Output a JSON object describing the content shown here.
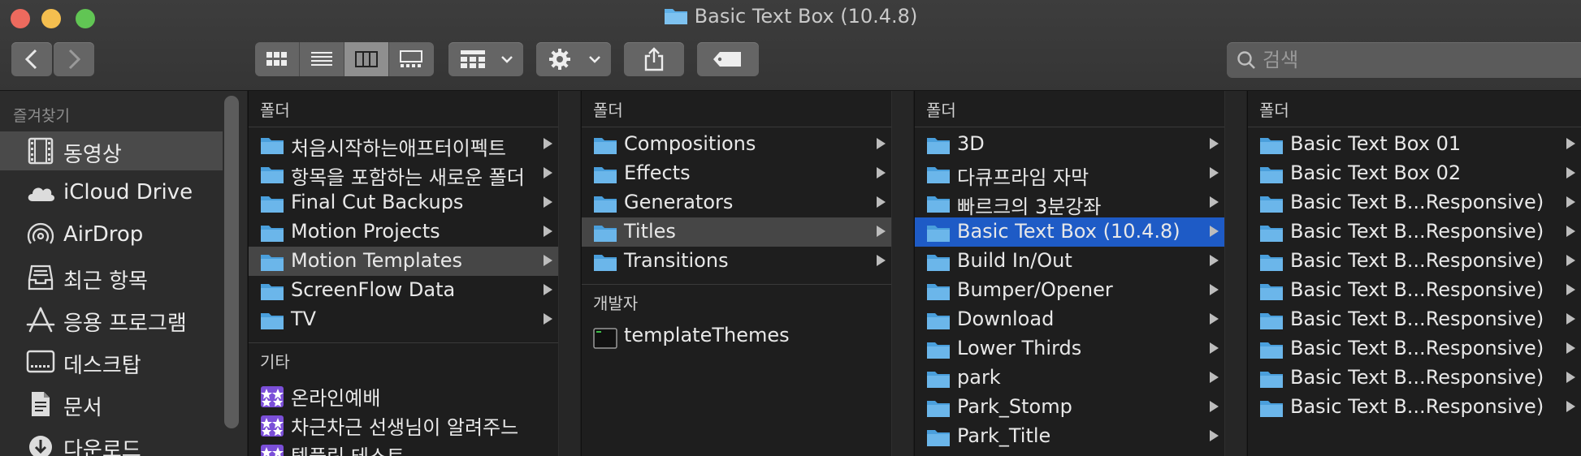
{
  "window": {
    "title": "Basic Text Box (10.4.8)"
  },
  "toolbar": {
    "nav_back_icon": "chevron-left-icon",
    "nav_forward_icon": "chevron-right-icon",
    "view_modes": [
      "icon-view",
      "list-view",
      "column-view",
      "gallery-view"
    ],
    "active_view": "column-view",
    "group_icon": "group-grid-icon",
    "action_icon": "gear-icon",
    "share_icon": "share-icon",
    "tag_icon": "tag-icon",
    "search_placeholder": "검색"
  },
  "sidebar": {
    "heading": "즐겨찾기",
    "items": [
      {
        "label": "동영상",
        "icon": "film-icon",
        "selected": true
      },
      {
        "label": "iCloud Drive",
        "icon": "cloud-icon",
        "selected": false
      },
      {
        "label": "AirDrop",
        "icon": "airdrop-icon",
        "selected": false
      },
      {
        "label": "최근 항목",
        "icon": "recents-tray-icon",
        "selected": false
      },
      {
        "label": "응용 프로그램",
        "icon": "applications-icon",
        "selected": false
      },
      {
        "label": "데스크탑",
        "icon": "desktop-icon",
        "selected": false
      },
      {
        "label": "문서",
        "icon": "document-icon",
        "selected": false
      },
      {
        "label": "다운로드",
        "icon": "download-icon",
        "selected": false
      }
    ]
  },
  "columns": [
    {
      "header": "폴더",
      "items": [
        {
          "name": "처음시작하는애프터이펙트",
          "arrow": true
        },
        {
          "name": "항목을 포함하는 새로운 폴더",
          "arrow": true
        },
        {
          "name": "Final Cut Backups",
          "arrow": true
        },
        {
          "name": "Motion Projects",
          "arrow": true
        },
        {
          "name": "Motion Templates",
          "arrow": true,
          "selected": "gray"
        },
        {
          "name": "ScreenFlow Data",
          "arrow": true
        },
        {
          "name": "TV",
          "arrow": true
        }
      ],
      "section2_header": "기타",
      "section2_items": [
        {
          "name": "온라인예배",
          "icon": "smart-folder-icon"
        },
        {
          "name": "차근차근 선생님이 알려주느",
          "icon": "smart-folder-icon"
        },
        {
          "name": "템플릿 테스트",
          "icon": "smart-folder-icon"
        }
      ]
    },
    {
      "header": "폴더",
      "items": [
        {
          "name": "Compositions",
          "arrow": true
        },
        {
          "name": "Effects",
          "arrow": true
        },
        {
          "name": "Generators",
          "arrow": true
        },
        {
          "name": "Titles",
          "arrow": true,
          "selected": "gray"
        },
        {
          "name": "Transitions",
          "arrow": true
        }
      ],
      "section2_header": "개발자",
      "section2_items": [
        {
          "name": "templateThemes",
          "icon": "terminal-file-icon"
        }
      ]
    },
    {
      "header": "폴더",
      "items": [
        {
          "name": "3D",
          "arrow": true
        },
        {
          "name": "다큐프라임 자막",
          "arrow": true
        },
        {
          "name": "빠르크의 3분강좌",
          "arrow": true
        },
        {
          "name": "Basic Text Box (10.4.8)",
          "arrow": true,
          "selected": "blue"
        },
        {
          "name": "Build In/Out",
          "arrow": true
        },
        {
          "name": "Bumper/Opener",
          "arrow": true
        },
        {
          "name": "Download",
          "arrow": true
        },
        {
          "name": "Lower Thirds",
          "arrow": true
        },
        {
          "name": "park",
          "arrow": true
        },
        {
          "name": "Park_Stomp",
          "arrow": true
        },
        {
          "name": "Park_Title",
          "arrow": true
        }
      ]
    },
    {
      "header": "폴더",
      "items": [
        {
          "name": "Basic Text Box 01",
          "arrow": true
        },
        {
          "name": "Basic Text Box 02",
          "arrow": true
        },
        {
          "name": "Basic Text B...Responsive)",
          "arrow": true
        },
        {
          "name": "Basic Text B...Responsive)",
          "arrow": true
        },
        {
          "name": "Basic Text B...Responsive)",
          "arrow": true
        },
        {
          "name": "Basic Text B...Responsive)",
          "arrow": true
        },
        {
          "name": "Basic Text B...Responsive)",
          "arrow": true
        },
        {
          "name": "Basic Text B...Responsive)",
          "arrow": true
        },
        {
          "name": "Basic Text B...Responsive)",
          "arrow": true
        },
        {
          "name": "Basic Text B...Responsive)",
          "arrow": true
        }
      ]
    }
  ],
  "colors": {
    "selection_blue": "#1e5bc6",
    "selection_gray": "#464646",
    "folder_blue": "#5fb0e8"
  }
}
